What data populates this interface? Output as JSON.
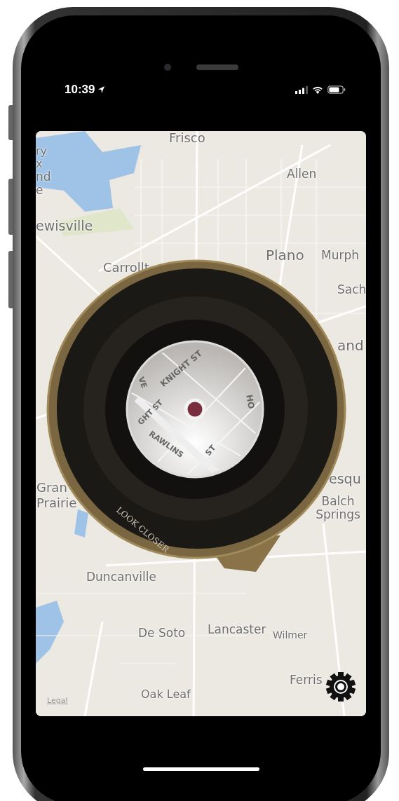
{
  "status_bar": {
    "time": "10:39"
  },
  "map": {
    "labels": [
      "Frisco",
      "ry",
      "x",
      "nd",
      "e",
      "Allen",
      "ewisville",
      "Plano",
      "Murph",
      "Carrollt",
      "Sach",
      "and",
      "esqu",
      "Gran",
      "Prairie",
      "Balch Springs",
      "Duncanville",
      "De Soto",
      "Lancaster",
      "Wilmer",
      "Oak Leaf",
      "Ferris"
    ],
    "legal": "Legal"
  },
  "magnifier": {
    "engraving": "LOOK CLOSER",
    "streets": [
      "KNIGHT ST",
      "VE",
      "GHT ST",
      "HO",
      "RAWLINS",
      "ST"
    ]
  }
}
